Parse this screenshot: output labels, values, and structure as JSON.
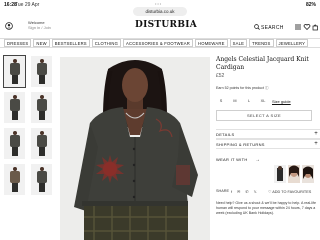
{
  "status_bar": {
    "time": "16:28",
    "date": "Tue 29 Apr",
    "indicators": "82%"
  },
  "browser": {
    "url": "disturbia.co.uk"
  },
  "header": {
    "welcome": "Welcome",
    "sign_in": "Sign in / Join",
    "logo": "DISTURBIA",
    "search_label": "SEARCH"
  },
  "nav": {
    "items": [
      "DRESSES",
      "NEW",
      "BESTSELLERS",
      "CLOTHING",
      "ACCESSORIES & FOOTWEAR",
      "HOMEWARE",
      "SALE",
      "TRENDS",
      "JEWELLERY"
    ]
  },
  "product": {
    "title": "Angels Celestial Jacquard Knit Cardigan",
    "price": "£52",
    "points_text": "Earn 52 points for this product ⓘ",
    "sizes": [
      "S",
      "M",
      "L",
      "XL"
    ],
    "size_guide": "Size guide",
    "select_button": "SELECT A SIZE",
    "accordions": [
      "DETAILS",
      "SHIPPING & RETURNS"
    ],
    "wear_with": "WEAR IT WITH",
    "share_label": "SHARE",
    "share_icons": "f ✉ ✆ 𝕏",
    "wishlist": "♡  ADD TO FAVOURITES",
    "help_text": "Need help? Give us a shout & we'll be happy to help. A real-life human will respond to your message within 24 hours, 7 days a week (excluding UK Bank Holidays)."
  },
  "colors": {
    "cardigan": "#3e3f3a",
    "skirt": "#3b3a2a",
    "accent_red": "#8a2f2a"
  }
}
